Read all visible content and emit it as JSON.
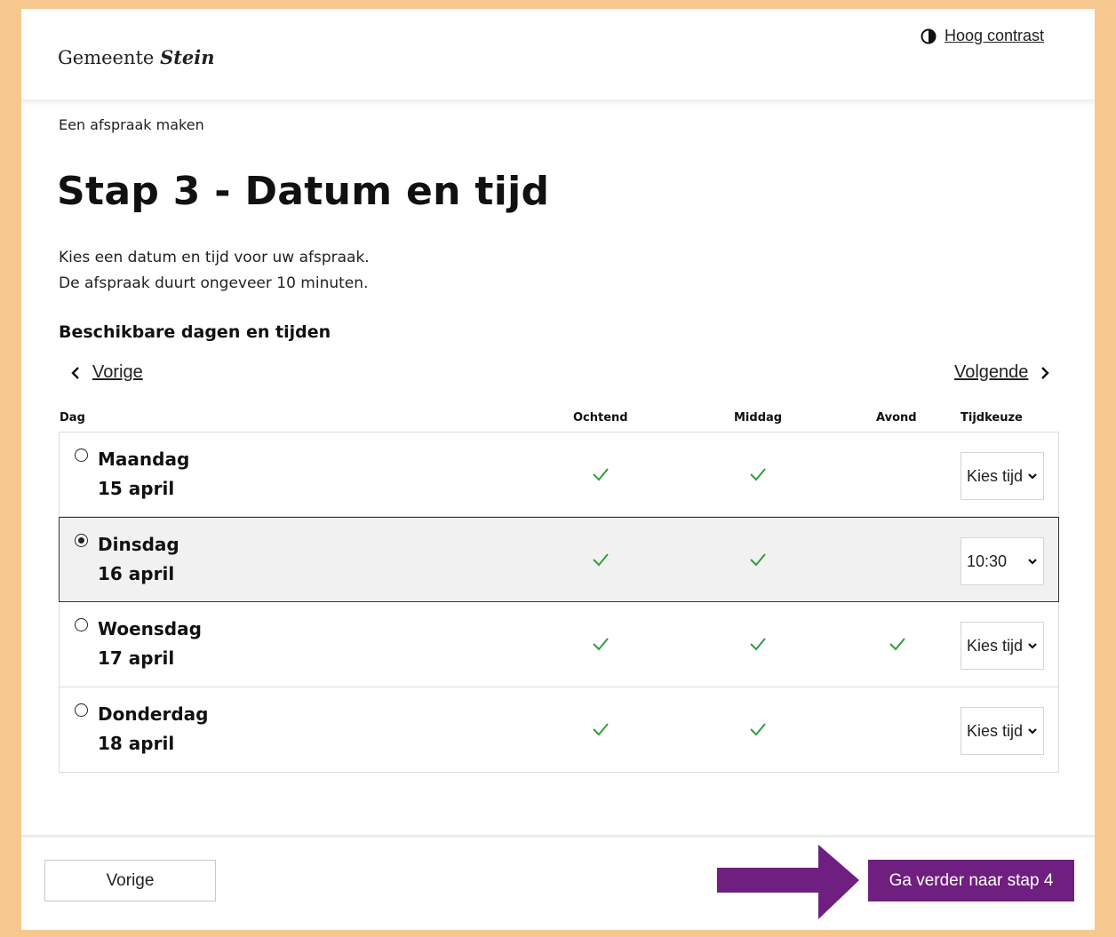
{
  "header": {
    "logo_prefix": "Gemeente",
    "logo_name": "Stein",
    "contrast_label": "Hoog contrast"
  },
  "breadcrumb": "Een afspraak maken",
  "title": "Stap 3 - Datum en tijd",
  "intro": {
    "line1": "Kies een datum en tijd voor uw afspraak.",
    "line2": "De afspraak duurt ongeveer 10 minuten."
  },
  "section_title": "Beschikbare dagen en tijden",
  "nav": {
    "prev_label": "Vorige",
    "next_label": "Volgende"
  },
  "columns": {
    "day": "Dag",
    "morning": "Ochtend",
    "afternoon": "Middag",
    "evening": "Avond",
    "time": "Tijdkeuze"
  },
  "rows": [
    {
      "day": "Maandag",
      "date": "15 april",
      "morning": true,
      "afternoon": true,
      "evening": false,
      "time": "Kies tijd",
      "selected": false
    },
    {
      "day": "Dinsdag",
      "date": "16 april",
      "morning": true,
      "afternoon": true,
      "evening": false,
      "time": "10:30",
      "selected": true
    },
    {
      "day": "Woensdag",
      "date": "17 april",
      "morning": true,
      "afternoon": true,
      "evening": true,
      "time": "Kies tijd",
      "selected": false
    },
    {
      "day": "Donderdag",
      "date": "18 april",
      "morning": true,
      "afternoon": true,
      "evening": false,
      "time": "Kies tijd",
      "selected": false
    }
  ],
  "footer": {
    "prev_button": "Vorige",
    "next_button": "Ga verder naar stap 4"
  },
  "colors": {
    "page_border": "#f6c88f",
    "primary_button": "#6f1f7f",
    "check": "#2e9e3e",
    "annotation_arrow": "#6f1f7f"
  }
}
